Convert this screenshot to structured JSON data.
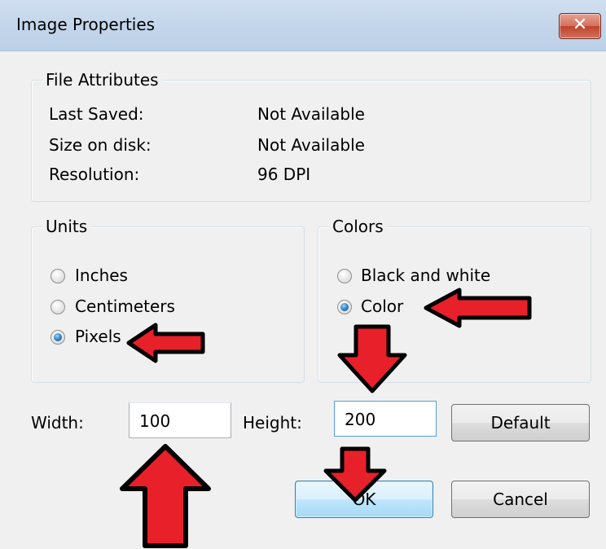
{
  "window": {
    "title": "Image Properties",
    "close_glyph": "✕"
  },
  "file_attributes": {
    "legend": "File Attributes",
    "rows": [
      {
        "label": "Last Saved:",
        "value": "Not Available"
      },
      {
        "label": "Size on disk:",
        "value": "Not Available"
      },
      {
        "label": "Resolution:",
        "value": "96 DPI"
      }
    ]
  },
  "units": {
    "legend": "Units",
    "options": [
      "Inches",
      "Centimeters",
      "Pixels"
    ],
    "selected": "Pixels"
  },
  "colors": {
    "legend": "Colors",
    "options": [
      "Black and white",
      "Color"
    ],
    "selected": "Color"
  },
  "size": {
    "width_label": "Width:",
    "width_value": "100",
    "height_label": "Height:",
    "height_value": "200"
  },
  "buttons": {
    "default": "Default",
    "ok": "OK",
    "cancel": "Cancel"
  },
  "annotation_colors": {
    "arrow_fill": "#e8202a",
    "arrow_stroke": "#000000"
  }
}
